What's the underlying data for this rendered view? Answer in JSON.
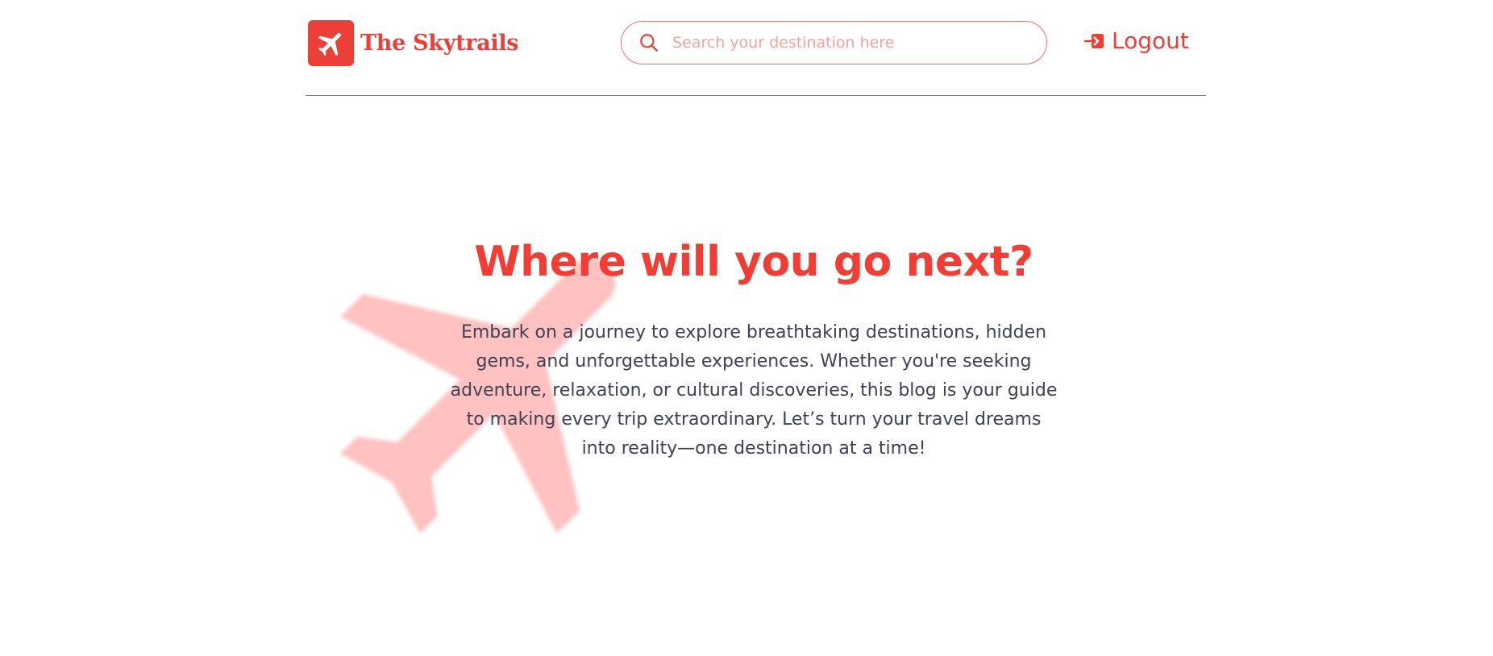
{
  "brand": {
    "name": "The Skytrails",
    "logo_icon": "airplane-icon",
    "accent_color": "#ec3f37"
  },
  "search": {
    "placeholder": "Search your destination here",
    "value": "",
    "icon": "search-icon"
  },
  "nav": {
    "logout_label": "Logout",
    "logout_icon": "logout-icon"
  },
  "hero": {
    "title": "Where will you go next?",
    "description": "Embark on a journey to explore breathtaking destinations, hidden gems, and unforgettable experiences. Whether you're seeking adventure, relaxation, or cultural discoveries, this blog is your guide to making every trip extraordinary. Let’s turn your travel dreams into reality—one destination at a time!",
    "background_icon": "airplane-icon"
  }
}
